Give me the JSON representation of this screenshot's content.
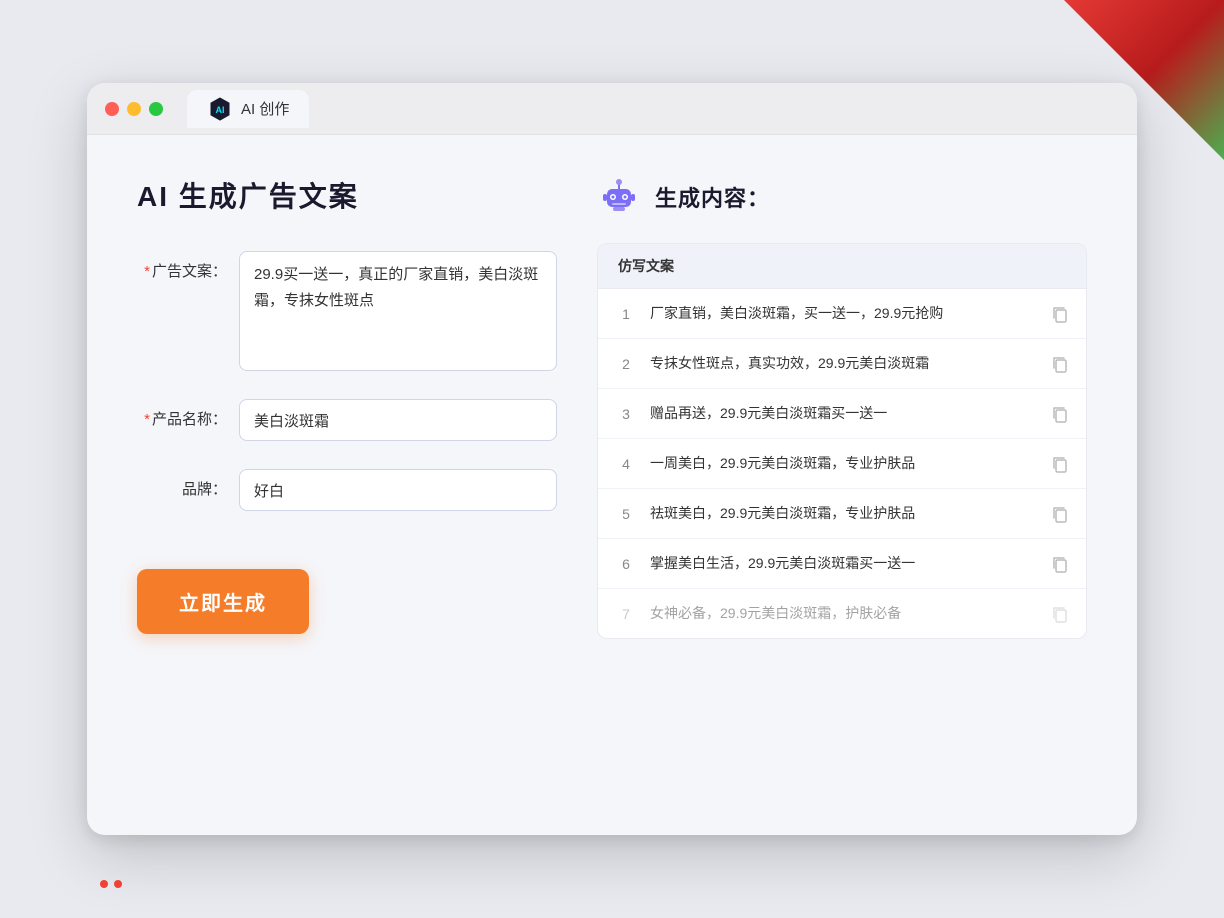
{
  "window": {
    "tab_label": "AI 创作"
  },
  "page": {
    "title": "AI 生成广告文案",
    "result_title": "生成内容："
  },
  "form": {
    "ad_copy_label": "广告文案：",
    "ad_copy_value": "29.9买一送一，真正的厂家直销，美白淡斑霜，专抹女性斑点",
    "product_name_label": "产品名称：",
    "product_name_value": "美白淡斑霜",
    "brand_label": "品牌：",
    "brand_value": "好白",
    "generate_button": "立即生成"
  },
  "results": {
    "table_header": "仿写文案",
    "rows": [
      {
        "id": 1,
        "text": "厂家直销，美白淡斑霜，买一送一，29.9元抢购",
        "dimmed": false
      },
      {
        "id": 2,
        "text": "专抹女性斑点，真实功效，29.9元美白淡斑霜",
        "dimmed": false
      },
      {
        "id": 3,
        "text": "赠品再送，29.9元美白淡斑霜买一送一",
        "dimmed": false
      },
      {
        "id": 4,
        "text": "一周美白，29.9元美白淡斑霜，专业护肤品",
        "dimmed": false
      },
      {
        "id": 5,
        "text": "祛斑美白，29.9元美白淡斑霜，专业护肤品",
        "dimmed": false
      },
      {
        "id": 6,
        "text": "掌握美白生活，29.9元美白淡斑霜买一送一",
        "dimmed": false
      },
      {
        "id": 7,
        "text": "女神必备，29.9元美白淡斑霜，护肤必备",
        "dimmed": true
      }
    ]
  },
  "colors": {
    "accent_orange": "#f57c28",
    "accent_purple": "#7c6ef7",
    "required_red": "#f44336"
  }
}
